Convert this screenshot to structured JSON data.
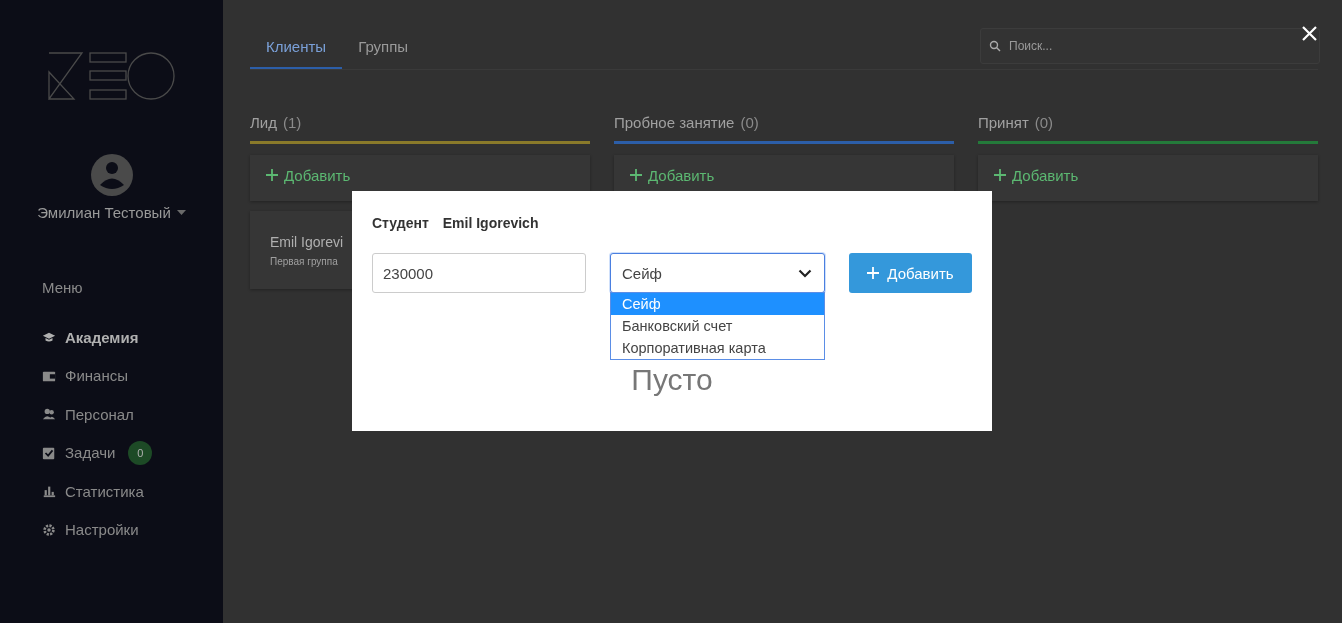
{
  "sidebar": {
    "user": {
      "name": "Эмилиан Тестовый"
    },
    "menu_label": "Меню",
    "items": [
      {
        "label": "Академия",
        "selected": true
      },
      {
        "label": "Финансы",
        "selected": false
      },
      {
        "label": "Персонал",
        "selected": false
      },
      {
        "label": "Задачи",
        "selected": false,
        "badge": "0"
      },
      {
        "label": "Статистика",
        "selected": false
      },
      {
        "label": "Настройки",
        "selected": false
      }
    ]
  },
  "tabs": [
    {
      "label": "Клиенты",
      "selected": true
    },
    {
      "label": "Группы",
      "selected": false
    }
  ],
  "search": {
    "placeholder": "Поиск..."
  },
  "columns": [
    {
      "title": "Лид",
      "count": "(1)",
      "color": "#8a7a2a",
      "add_label": "Добавить",
      "cards": [
        {
          "name": "Emil Igorevi",
          "group": "Первая группа"
        }
      ]
    },
    {
      "title": "Пробное занятие",
      "count": "(0)",
      "color": "#2c5ea8",
      "add_label": "Добавить"
    },
    {
      "title": "Принят",
      "count": "(0)",
      "color": "#247a3a",
      "add_label": "Добавить"
    }
  ],
  "modal": {
    "label": "Студент",
    "student": "Emil Igorevich",
    "amount": "230000",
    "select": {
      "value": "Сейф",
      "expanded": true,
      "options": [
        {
          "label": "Сейф",
          "selected": true
        },
        {
          "label": "Банковский счет",
          "selected": false
        },
        {
          "label": "Корпоративная карта",
          "selected": false
        }
      ]
    },
    "button": "Добавить",
    "empty": "Пусто"
  }
}
